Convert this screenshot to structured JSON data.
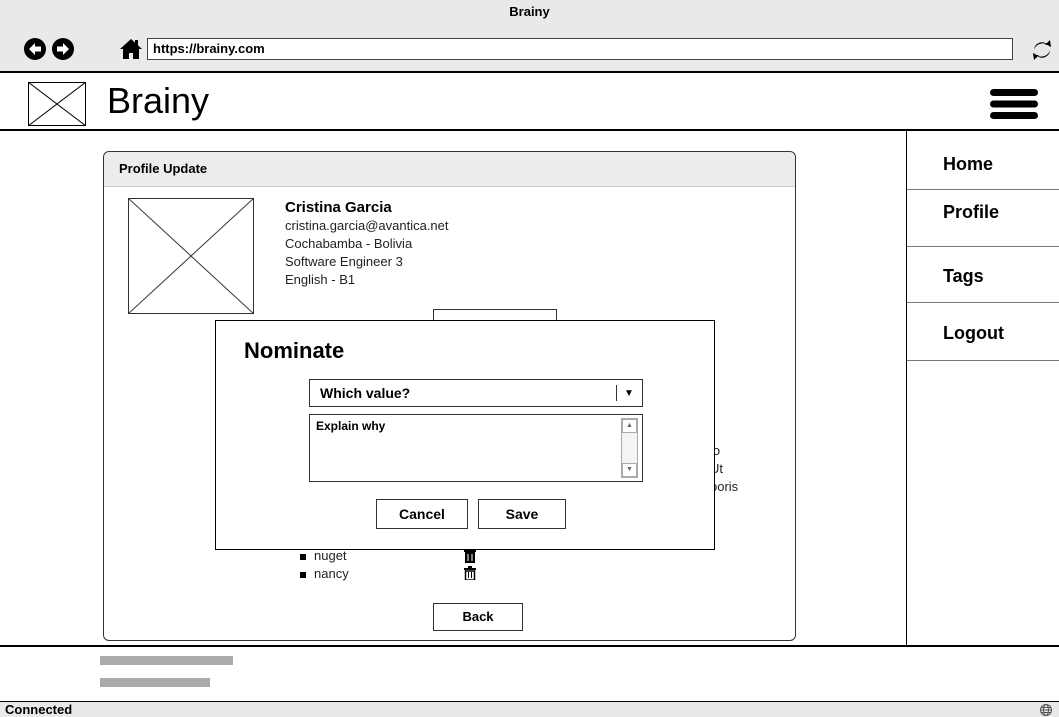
{
  "browser": {
    "title": "Brainy",
    "url": "https://brainy.com"
  },
  "app": {
    "brand": "Brainy"
  },
  "sidenav": {
    "items": [
      {
        "label": "Home"
      },
      {
        "label": "Profile"
      },
      {
        "label": "Tags"
      },
      {
        "label": "Logout"
      }
    ]
  },
  "panel": {
    "title": "Profile Update",
    "name": "Cristina Garcia",
    "email": "cristina.garcia@avantica.net",
    "location": "Cochabamba - Bolivia",
    "role": "Software Engineer 3",
    "language": "English - B1",
    "obscured_text": [
      "lo",
      "Ut",
      "boris"
    ],
    "tags": [
      "nuget",
      "nancy"
    ],
    "back_label": "Back"
  },
  "modal": {
    "title": "Nominate",
    "select_value": "Which value?",
    "textarea_placeholder": "Explain why",
    "cancel_label": "Cancel",
    "save_label": "Save"
  },
  "status": {
    "text": "Connected"
  }
}
